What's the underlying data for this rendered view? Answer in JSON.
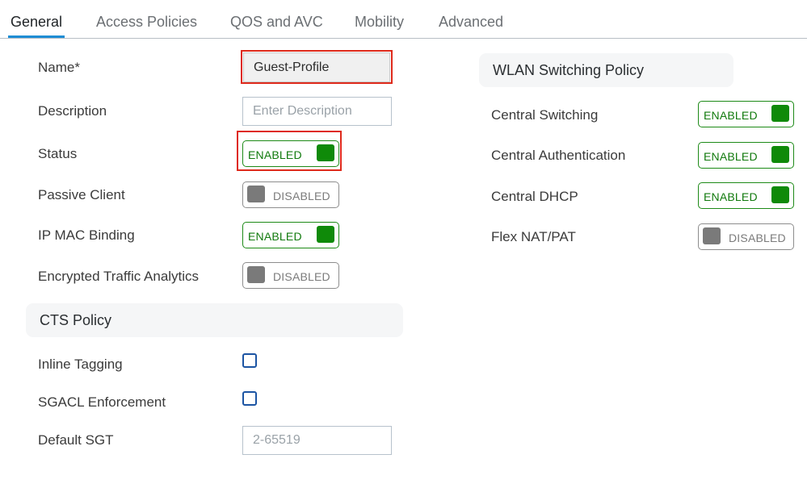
{
  "tabs": [
    {
      "label": "General",
      "active": true
    },
    {
      "label": "Access Policies",
      "active": false
    },
    {
      "label": "QOS and AVC",
      "active": false
    },
    {
      "label": "Mobility",
      "active": false
    },
    {
      "label": "Advanced",
      "active": false
    }
  ],
  "general": {
    "name_label": "Name*",
    "name_value": "Guest-Profile",
    "description_label": "Description",
    "description_placeholder": "Enter Description",
    "status_label": "Status",
    "status_toggle": "ENABLED",
    "passive_client_label": "Passive Client",
    "passive_client_toggle": "DISABLED",
    "ip_mac_binding_label": "IP MAC Binding",
    "ip_mac_binding_toggle": "ENABLED",
    "encrypted_traffic_label": "Encrypted Traffic Analytics",
    "encrypted_traffic_toggle": "DISABLED"
  },
  "cts_policy": {
    "title": "CTS Policy",
    "inline_tagging_label": "Inline Tagging",
    "inline_tagging_checked": false,
    "sgacl_label": "SGACL Enforcement",
    "sgacl_checked": false,
    "default_sgt_label": "Default SGT",
    "default_sgt_placeholder": "2-65519"
  },
  "wlan_switching": {
    "title": "WLAN Switching Policy",
    "central_switching_label": "Central Switching",
    "central_switching_toggle": "ENABLED",
    "central_auth_label": "Central Authentication",
    "central_auth_toggle": "ENABLED",
    "central_dhcp_label": "Central DHCP",
    "central_dhcp_toggle": "ENABLED",
    "flex_nat_label": "Flex NAT/PAT",
    "flex_nat_toggle": "DISABLED"
  },
  "colors": {
    "accent": "#1e8dd4",
    "enabled_green": "#0f8a09",
    "disabled_gray": "#7a7a7a",
    "highlight_red": "#de2a1b",
    "checkbox_blue": "#1b54a3"
  }
}
